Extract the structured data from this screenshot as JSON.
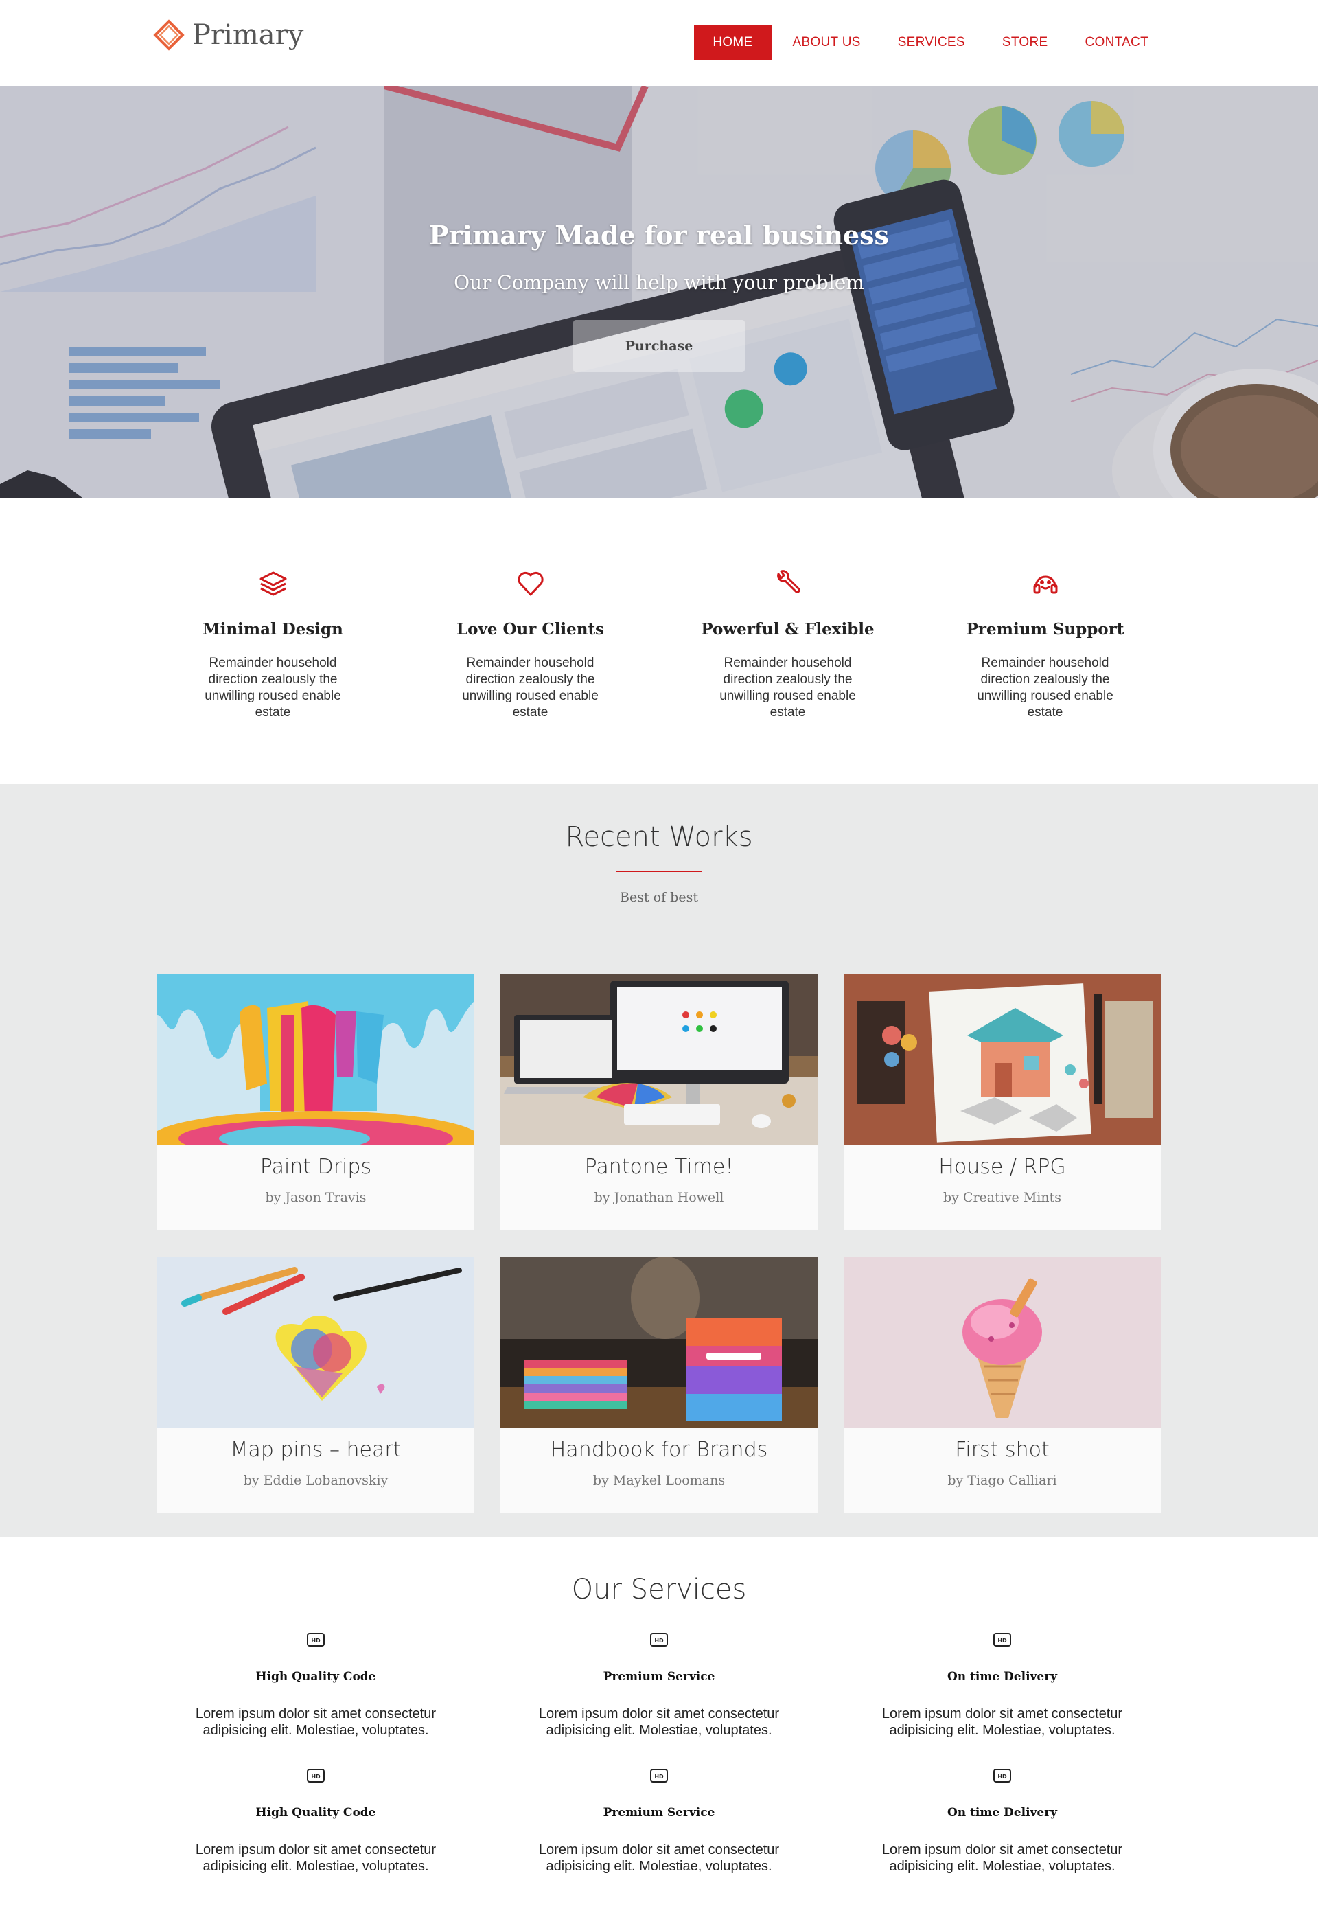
{
  "brand": {
    "name": "Primary",
    "accent": "#d0191c"
  },
  "nav": {
    "items": [
      {
        "label": "HOME",
        "active": true
      },
      {
        "label": "ABOUT US"
      },
      {
        "label": "SERVICES"
      },
      {
        "label": "STORE"
      },
      {
        "label": "CONTACT"
      }
    ]
  },
  "hero": {
    "title": "Primary Made for real business",
    "subtitle": "Our Company will help with your problem",
    "button_label": "Purchase"
  },
  "features": [
    {
      "icon": "layers-icon",
      "title": "Minimal Design",
      "text": "Remainder household direction zealously the unwilling roused enable estate"
    },
    {
      "icon": "heart-icon",
      "title": "Love Our Clients",
      "text": "Remainder household direction zealously the unwilling roused enable estate"
    },
    {
      "icon": "wrench-icon",
      "title": "Powerful & Flexible",
      "text": "Remainder household direction zealously the unwilling roused enable estate"
    },
    {
      "icon": "headset-icon",
      "title": "Premium Support",
      "text": "Remainder household direction zealously the unwilling roused enable estate"
    }
  ],
  "works": {
    "title": "Recent Works",
    "subtitle": "Best of best",
    "items": [
      {
        "title": "Paint Drips",
        "author": "by Jason Travis"
      },
      {
        "title": "Pantone Time!",
        "author": "by Jonathan Howell"
      },
      {
        "title": "House / RPG",
        "author": "by Creative Mints"
      },
      {
        "title": "Map pins – heart",
        "author": "by Eddie Lobanovskiy"
      },
      {
        "title": "Handbook for Brands",
        "author": "by Maykel Loomans"
      },
      {
        "title": "First shot",
        "author": "by Tiago Calliari"
      }
    ]
  },
  "services": {
    "title": "Our Services",
    "items": [
      {
        "icon": "hd-icon",
        "title": "High Quality Code",
        "text": "Lorem ipsum dolor sit amet consectetur adipisicing elit. Molestiae, voluptates."
      },
      {
        "icon": "hd-icon",
        "title": "Premium Service",
        "text": "Lorem ipsum dolor sit amet consectetur adipisicing elit. Molestiae, voluptates."
      },
      {
        "icon": "hd-icon",
        "title": "On time Delivery",
        "text": "Lorem ipsum dolor sit amet consectetur adipisicing elit. Molestiae, voluptates."
      },
      {
        "icon": "hd-icon",
        "title": "High Quality Code",
        "text": "Lorem ipsum dolor sit amet consectetur adipisicing elit. Molestiae, voluptates."
      },
      {
        "icon": "hd-icon",
        "title": "Premium Service",
        "text": "Lorem ipsum dolor sit amet consectetur adipisicing elit. Molestiae, voluptates."
      },
      {
        "icon": "hd-icon",
        "title": "On time Delivery",
        "text": "Lorem ipsum dolor sit amet consectetur adipisicing elit. Molestiae, voluptates."
      }
    ]
  }
}
